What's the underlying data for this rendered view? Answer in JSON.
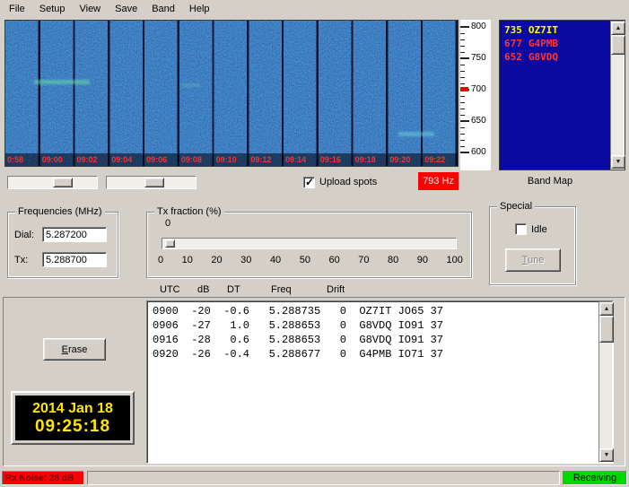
{
  "colors": {
    "accent_red": "#ff0000",
    "status_green": "#00d800",
    "bandmap_bg": "#0a0aa0",
    "clock_text": "#ffe600",
    "spot_time_red": "#ff2f2f"
  },
  "menu": {
    "items": [
      "File",
      "Setup",
      "View",
      "Save",
      "Band",
      "Help"
    ]
  },
  "waterfall": {
    "time_labels": [
      "0:58",
      "09:00",
      "09:02",
      "09:04",
      "09:06",
      "09:08",
      "09:10",
      "09:12",
      "09:14",
      "09:16",
      "09:18",
      "09:20",
      "09:22"
    ],
    "freq_scale_labels": [
      "800",
      "750",
      "700",
      "650",
      "600"
    ]
  },
  "band_map": {
    "label": "Band Map",
    "entries": [
      {
        "freq": "735",
        "call": "OZ7IT",
        "color": "#ffff00"
      },
      {
        "freq": "677",
        "call": "G4PMB",
        "color": "#ff3535"
      },
      {
        "freq": "652",
        "call": "G8VDQ",
        "color": "#ff3535"
      }
    ]
  },
  "controls": {
    "upload_spots_label": "Upload spots",
    "upload_spots_checked": true,
    "rx_freq_marker": "793 Hz"
  },
  "frequencies": {
    "title": "Frequencies (MHz)",
    "dial_label": "Dial:",
    "dial_value": "5.287200",
    "tx_label": "Tx:",
    "tx_value": "5.288700"
  },
  "tx_fraction": {
    "title": "Tx fraction (%)",
    "current_value": "0",
    "scale_labels": [
      "0",
      "10",
      "20",
      "30",
      "40",
      "50",
      "60",
      "70",
      "80",
      "90",
      "100"
    ]
  },
  "special": {
    "title": "Special",
    "idle_label": "Idle",
    "idle_checked": false,
    "tune_label": "Tune"
  },
  "decodes": {
    "headers": [
      "UTC",
      "dB",
      "DT",
      "Freq",
      "Drift"
    ],
    "rows": [
      {
        "utc": "0900",
        "db": "-20",
        "dt": "-0.6",
        "freq": "5.288735",
        "drift": "0",
        "message": "OZ7IT JO65 37"
      },
      {
        "utc": "0906",
        "db": "-27",
        "dt": "1.0",
        "freq": "5.288653",
        "drift": "0",
        "message": "G8VDQ IO91 37"
      },
      {
        "utc": "0916",
        "db": "-28",
        "dt": "0.6",
        "freq": "5.288653",
        "drift": "0",
        "message": "G8VDQ IO91 37"
      },
      {
        "utc": "0920",
        "db": "-26",
        "dt": "-0.4",
        "freq": "5.288677",
        "drift": "0",
        "message": "G4PMB IO71 37"
      }
    ]
  },
  "buttons": {
    "erase": "Erase"
  },
  "clock": {
    "date": "2014 Jan 18",
    "time": "09:25:18"
  },
  "status": {
    "rx_noise": "Rx Noise: 28 dB",
    "mode": "Receiving"
  }
}
